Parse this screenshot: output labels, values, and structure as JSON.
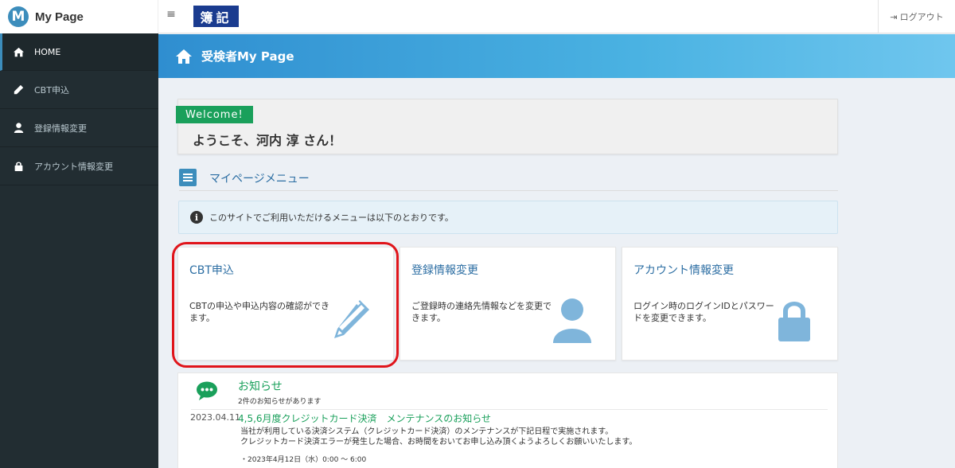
{
  "brand": {
    "logo_letter": "M",
    "name": "My Page"
  },
  "topbar": {
    "menu_icon": "hamburger-icon",
    "badge": "簿記",
    "logout_label": "ログアウト",
    "logout_icon": "sign-out-icon"
  },
  "sidebar": {
    "items": [
      {
        "label": "HOME",
        "icon": "home-icon",
        "active": true
      },
      {
        "label": "CBT申込",
        "icon": "pencil-icon",
        "active": false
      },
      {
        "label": "登録情報変更",
        "icon": "user-icon",
        "active": false
      },
      {
        "label": "アカウント情報変更",
        "icon": "lock-icon",
        "active": false
      }
    ]
  },
  "header": {
    "title": "受検者My Page",
    "icon": "home-icon"
  },
  "welcome": {
    "tag": "Welcome!",
    "message": "ようこそ、河内 淳 さん！"
  },
  "menu": {
    "title": "マイページメニュー",
    "icon": "list-icon"
  },
  "info": {
    "text": "このサイトでご利用いただけるメニューは以下のとおりです。",
    "icon": "info-icon"
  },
  "cards": [
    {
      "title": "CBT申込",
      "desc": "CBTの申込や申込内容の確認ができます。",
      "icon": "pencil-icon"
    },
    {
      "title": "登録情報変更",
      "desc": "ご登録時の連絡先情報などを変更できます。",
      "icon": "user-icon"
    },
    {
      "title": "アカウント情報変更",
      "desc": "ログイン時のログインIDとパスワードを変更できます。",
      "icon": "lock-icon"
    }
  ],
  "news": {
    "title": "お知らせ",
    "count_text": "2件のお知らせがあります",
    "icon": "comment-icon",
    "items": [
      {
        "date": "2023.04.11",
        "headline": "4,5,6月度クレジットカード決済　メンテナンスのお知らせ",
        "body1": "当社が利用している決済システム（クレジットカード決済）のメンテナンスが下記日程で実施されます。",
        "body2": "クレジットカード決済エラーが発生した場合、お時間をおいてお申し込み頂くようよろしくお願いいたします。",
        "schedule": "・2023年4月12日（水）0:00 ～ 6:00"
      }
    ]
  },
  "colors": {
    "sidebar_bg": "#222d32",
    "accent": "#3c8dbc",
    "green": "#1aa05b",
    "highlight": "#e0151b"
  }
}
